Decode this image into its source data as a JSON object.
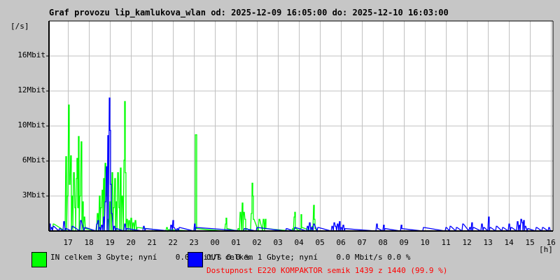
{
  "title": "Graf provozu lip_kamlukova_wlan od: 2025-12-09 16:05:00 do: 2025-12-10 16:03:00",
  "legend": {
    "in_text": "IN celkem 3 Gbyte; nyní    0.0 Mbit/s 0.0 %",
    "out_text": "OUT celkem 1 Gbyte; nyní    0.0 Mbit/s 0.0 %",
    "availability": "Dostupnost E220 KOMPAKTOR semik 1439 z 1440 (99.9 %)"
  },
  "colors": {
    "in": "#00ff00",
    "out": "#0000ff",
    "grid": "#c0c0c0",
    "availability": "#ff0000"
  },
  "chart_data": {
    "type": "line",
    "title": "Graf provozu lip_kamlukova_wlan od: 2025-12-09 16:05:00 do: 2025-12-10 16:03:00",
    "ylabel": "[/s]",
    "xlabel": "[h]",
    "start_hour_offset_min": 5,
    "x_range_hours": [
      0,
      24
    ],
    "y_ticks": [
      {
        "value": 3,
        "label": "3Mbit"
      },
      {
        "value": 6,
        "label": "6Mbit"
      },
      {
        "value": 10,
        "label": "10Mbit"
      },
      {
        "value": 12,
        "label": "12Mbit"
      },
      {
        "value": 16,
        "label": "16Mbit"
      }
    ],
    "y_top": 20,
    "x_ticks": [
      "17",
      "18",
      "19",
      "20",
      "21",
      "22",
      "23",
      "00",
      "01",
      "02",
      "03",
      "04",
      "05",
      "06",
      "07",
      "08",
      "09",
      "10",
      "11",
      "12",
      "13",
      "14",
      "15",
      "16"
    ],
    "grid": true,
    "series": [
      {
        "name": "IN",
        "color": "#00ff00",
        "points": [
          [
            0.1,
            0.3
          ],
          [
            0.2,
            0.6
          ],
          [
            0.8,
            6.5
          ],
          [
            0.87,
            3
          ],
          [
            0.93,
            11.2
          ],
          [
            0.97,
            4
          ],
          [
            1.03,
            6.6
          ],
          [
            1.1,
            3
          ],
          [
            1.17,
            5
          ],
          [
            1.23,
            2
          ],
          [
            1.3,
            4.5
          ],
          [
            1.33,
            6.3
          ],
          [
            1.37,
            2
          ],
          [
            1.4,
            8.8
          ],
          [
            1.47,
            3
          ],
          [
            1.53,
            8.2
          ],
          [
            1.6,
            2.5
          ],
          [
            1.67,
            1.2
          ],
          [
            1.73,
            0.2
          ],
          [
            2.3,
            1.5
          ],
          [
            2.4,
            3
          ],
          [
            2.47,
            2
          ],
          [
            2.53,
            3.5
          ],
          [
            2.6,
            4.5
          ],
          [
            2.67,
            5.8
          ],
          [
            2.73,
            3
          ],
          [
            2.8,
            1
          ],
          [
            2.9,
            2.5
          ],
          [
            3.0,
            5
          ],
          [
            3.07,
            2
          ],
          [
            3.13,
            4.5
          ],
          [
            3.2,
            2.5
          ],
          [
            3.27,
            5
          ],
          [
            3.33,
            2
          ],
          [
            3.4,
            5.4
          ],
          [
            3.47,
            3
          ],
          [
            3.57,
            6.1
          ],
          [
            3.6,
            11.4
          ],
          [
            3.63,
            5
          ],
          [
            3.7,
            1
          ],
          [
            3.8,
            0.9
          ],
          [
            3.9,
            1.1
          ],
          [
            4.0,
            0.7
          ],
          [
            4.1,
            0.9
          ],
          [
            4.2,
            0.3
          ],
          [
            5.6,
            0.3
          ],
          [
            5.7,
            0.1
          ],
          [
            6.93,
            0.2
          ],
          [
            6.97,
            9.0
          ],
          [
            7.0,
            9.0
          ],
          [
            7.03,
            0.2
          ],
          [
            8.4,
            0.6
          ],
          [
            8.43,
            1.1
          ],
          [
            8.47,
            0.2
          ],
          [
            9.0,
            0.2
          ],
          [
            9.1,
            1.6
          ],
          [
            9.2,
            2.4
          ],
          [
            9.27,
            1.6
          ],
          [
            9.33,
            1.0
          ],
          [
            9.4,
            0.2
          ],
          [
            9.63,
            1.5
          ],
          [
            9.67,
            4.1
          ],
          [
            9.7,
            3
          ],
          [
            9.73,
            1.0
          ],
          [
            10.0,
            1.0
          ],
          [
            10.2,
            1.0
          ],
          [
            10.3,
            1.0
          ],
          [
            10.33,
            0.2
          ],
          [
            11.6,
            0.2
          ],
          [
            11.67,
            1.2
          ],
          [
            11.7,
            1.6
          ],
          [
            11.73,
            0.2
          ],
          [
            11.97,
            0.2
          ],
          [
            12.0,
            1.4
          ],
          [
            12.03,
            0.3
          ],
          [
            12.53,
            0.4
          ],
          [
            12.6,
            2.2
          ],
          [
            12.63,
            1.0
          ],
          [
            12.67,
            0.2
          ]
        ]
      },
      {
        "name": "OUT",
        "color": "#0000ff",
        "points": [
          [
            0.03,
            0.6
          ],
          [
            0.1,
            0.3
          ],
          [
            0.2,
            0.4
          ],
          [
            0.5,
            0.2
          ],
          [
            0.7,
            0.8
          ],
          [
            0.8,
            0.2
          ],
          [
            1.1,
            0.4
          ],
          [
            1.5,
            0.9
          ],
          [
            1.7,
            0.3
          ],
          [
            2.27,
            0.6
          ],
          [
            2.33,
            0.9
          ],
          [
            2.4,
            0.3
          ],
          [
            2.5,
            0.5
          ],
          [
            2.6,
            1.2
          ],
          [
            2.67,
            2.5
          ],
          [
            2.73,
            5.5
          ],
          [
            2.8,
            8.9
          ],
          [
            2.87,
            11.6
          ],
          [
            2.9,
            9.5
          ],
          [
            2.93,
            4
          ],
          [
            2.97,
            1.5
          ],
          [
            3.1,
            0.4
          ],
          [
            3.2,
            0.2
          ],
          [
            3.6,
            0.6
          ],
          [
            3.7,
            0.2
          ],
          [
            4.5,
            0.4
          ],
          [
            4.6,
            0.2
          ],
          [
            5.8,
            0.5
          ],
          [
            5.9,
            0.9
          ],
          [
            5.93,
            0.3
          ],
          [
            6.1,
            0.2
          ],
          [
            6.2,
            0.3
          ],
          [
            6.93,
            0.6
          ],
          [
            7.0,
            0.3
          ],
          [
            9.3,
            0.2
          ],
          [
            9.9,
            0.3
          ],
          [
            11.3,
            0.2
          ],
          [
            11.7,
            0.3
          ],
          [
            12.3,
            0.4
          ],
          [
            12.4,
            0.7
          ],
          [
            12.5,
            0.3
          ],
          [
            12.6,
            0.6
          ],
          [
            12.8,
            0.3
          ],
          [
            13.47,
            0.4
          ],
          [
            13.57,
            0.7
          ],
          [
            13.63,
            0.4
          ],
          [
            13.73,
            0.6
          ],
          [
            13.83,
            0.8
          ],
          [
            13.9,
            0.3
          ],
          [
            14.0,
            0.5
          ],
          [
            14.1,
            0.2
          ],
          [
            15.6,
            0.6
          ],
          [
            15.65,
            0.2
          ],
          [
            15.93,
            0.5
          ],
          [
            16.0,
            0.2
          ],
          [
            16.77,
            0.5
          ],
          [
            16.8,
            0.2
          ],
          [
            17.83,
            0.3
          ],
          [
            18.9,
            0.3
          ],
          [
            19.1,
            0.4
          ],
          [
            19.4,
            0.3
          ],
          [
            19.7,
            0.6
          ],
          [
            20.03,
            0.3
          ],
          [
            20.13,
            0.7
          ],
          [
            20.2,
            0.3
          ],
          [
            20.6,
            0.6
          ],
          [
            20.7,
            0.3
          ],
          [
            20.93,
            1.2
          ],
          [
            21.0,
            0.3
          ],
          [
            21.3,
            0.4
          ],
          [
            21.6,
            0.3
          ],
          [
            21.9,
            0.6
          ],
          [
            22.0,
            0.3
          ],
          [
            22.3,
            0.8
          ],
          [
            22.4,
            0.5
          ],
          [
            22.47,
            1.0
          ],
          [
            22.53,
            0.7
          ],
          [
            22.6,
            0.9
          ],
          [
            22.67,
            0.4
          ],
          [
            22.8,
            0.2
          ],
          [
            23.2,
            0.3
          ],
          [
            23.5,
            0.3
          ],
          [
            23.8,
            0.3
          ]
        ]
      }
    ]
  }
}
